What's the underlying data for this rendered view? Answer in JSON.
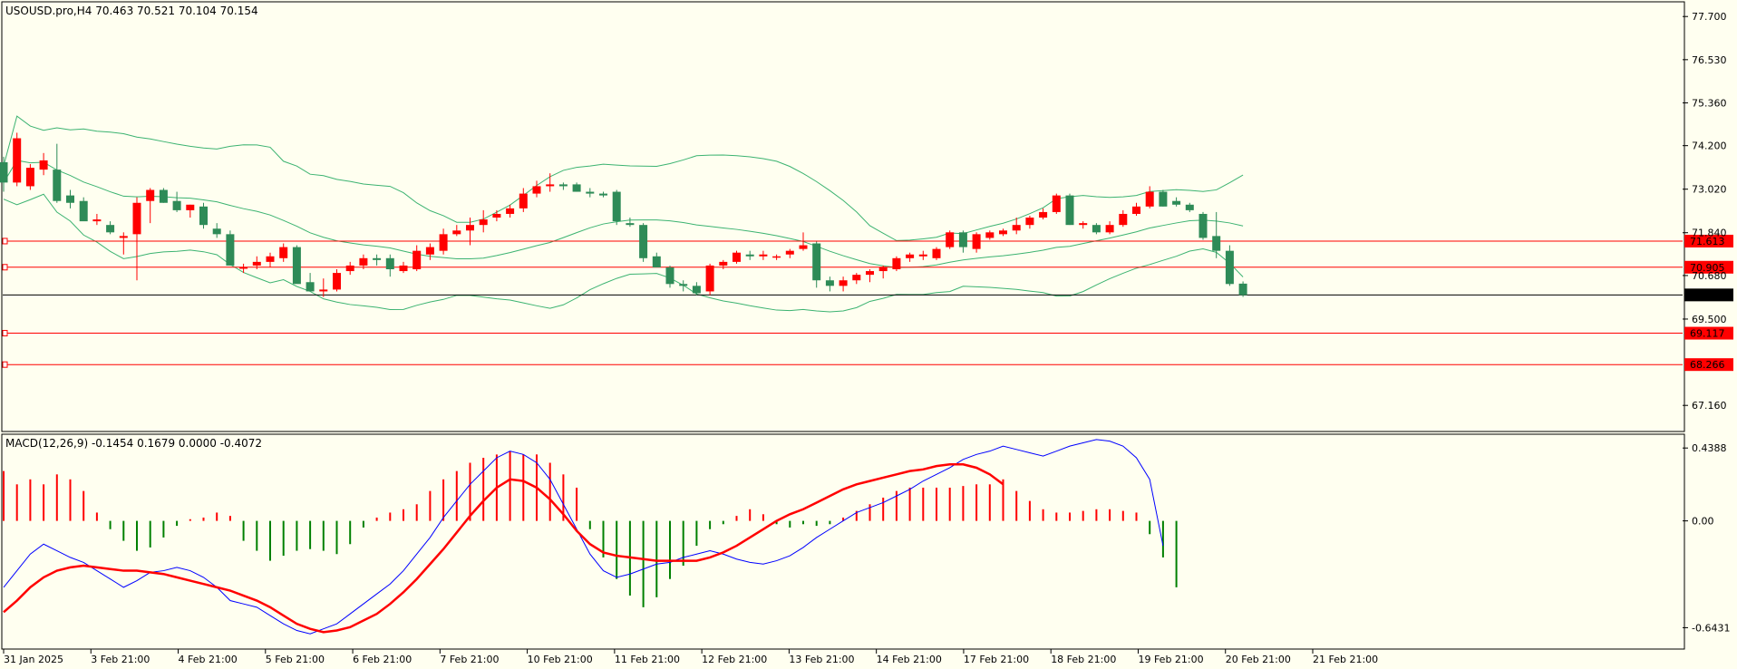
{
  "price_panel": {
    "header": "USOUSD.pro,H4  70.463 70.521 70.104 70.154",
    "price_ticks": [
      "77.700",
      "76.530",
      "75.360",
      "74.200",
      "73.020",
      "71.840",
      "70.680",
      "69.500",
      "67.160"
    ],
    "current_price_label": "70.154",
    "hlines": [
      {
        "label": "71.613",
        "value": 71.613
      },
      {
        "label": "70.905",
        "value": 70.905
      },
      {
        "label": "69.117",
        "value": 69.117
      },
      {
        "label": "68.266",
        "value": 68.266
      }
    ]
  },
  "macd_panel": {
    "header": "MACD(12,26,9) -0.1454 0.1679 0.0000 -0.4072",
    "ticks": [
      "0.4388",
      "0.00",
      "-0.6431"
    ]
  },
  "time_labels": [
    "31 Jan 2025",
    "3 Feb 21:00",
    "4 Feb 21:00",
    "5 Feb 21:00",
    "6 Feb 21:00",
    "7 Feb 21:00",
    "10 Feb 21:00",
    "11 Feb 21:00",
    "12 Feb 21:00",
    "13 Feb 21:00",
    "14 Feb 21:00",
    "17 Feb 21:00",
    "18 Feb 21:00",
    "19 Feb 21:00",
    "20 Feb 21:00",
    "21 Feb 21:00"
  ],
  "colors": {
    "background": "#fffff0",
    "bull": "#ff0000",
    "bear": "#2e8b57",
    "band": "#3cb371",
    "hline": "#ff0000",
    "macd_line": "#0000ff",
    "signal_line": "#ff0000",
    "hist_pos": "#ff0000",
    "hist_neg": "#008000"
  },
  "chart_data": {
    "type": "candlestick",
    "symbol": "USOUSD.pro",
    "timeframe": "H4",
    "ohlc_last": {
      "open": 70.463,
      "high": 70.521,
      "low": 70.104,
      "close": 70.154
    },
    "y_range": [
      66.6,
      78.0
    ],
    "candles": [
      [
        73.75,
        73.9,
        72.95,
        73.2
      ],
      [
        73.2,
        74.55,
        73.1,
        74.4
      ],
      [
        73.1,
        73.7,
        73.0,
        73.6
      ],
      [
        73.55,
        74.0,
        73.4,
        73.8
      ],
      [
        73.55,
        74.25,
        72.65,
        72.7
      ],
      [
        72.85,
        73.0,
        72.5,
        72.65
      ],
      [
        72.7,
        72.8,
        72.25,
        72.15
      ],
      [
        72.15,
        72.35,
        72.05,
        72.2
      ],
      [
        72.05,
        72.15,
        71.8,
        71.85
      ],
      [
        71.7,
        71.85,
        71.25,
        71.75
      ],
      [
        71.8,
        72.8,
        70.55,
        72.65
      ],
      [
        72.7,
        73.05,
        72.1,
        73.0
      ],
      [
        73.0,
        73.05,
        72.65,
        72.65
      ],
      [
        72.7,
        72.95,
        72.4,
        72.45
      ],
      [
        72.45,
        72.6,
        72.25,
        72.6
      ],
      [
        72.55,
        72.65,
        71.95,
        72.05
      ],
      [
        71.95,
        72.1,
        71.7,
        71.8
      ],
      [
        71.8,
        71.9,
        70.95,
        70.95
      ],
      [
        70.9,
        71.0,
        70.75,
        70.9
      ],
      [
        70.95,
        71.2,
        70.85,
        71.05
      ],
      [
        71.05,
        71.3,
        70.9,
        71.2
      ],
      [
        71.15,
        71.55,
        71.05,
        71.45
      ],
      [
        71.45,
        71.5,
        70.55,
        70.45
      ],
      [
        70.5,
        70.75,
        70.35,
        70.25
      ],
      [
        70.25,
        70.6,
        70.1,
        70.3
      ],
      [
        70.3,
        70.85,
        70.25,
        70.75
      ],
      [
        70.8,
        71.05,
        70.7,
        70.95
      ],
      [
        70.95,
        71.25,
        70.85,
        71.15
      ],
      [
        71.15,
        71.25,
        70.95,
        71.1
      ],
      [
        71.15,
        71.25,
        70.65,
        70.85
      ],
      [
        70.8,
        71.05,
        70.75,
        70.95
      ],
      [
        70.85,
        71.5,
        70.8,
        71.35
      ],
      [
        71.25,
        71.55,
        71.1,
        71.45
      ],
      [
        71.35,
        71.95,
        71.25,
        71.8
      ],
      [
        71.8,
        72.05,
        71.75,
        71.9
      ],
      [
        71.9,
        72.25,
        71.5,
        72.05
      ],
      [
        72.05,
        72.45,
        71.85,
        72.2
      ],
      [
        72.25,
        72.45,
        72.15,
        72.35
      ],
      [
        72.35,
        72.6,
        72.25,
        72.5
      ],
      [
        72.5,
        73.05,
        72.4,
        72.9
      ],
      [
        72.9,
        73.25,
        72.8,
        73.1
      ],
      [
        73.1,
        73.45,
        72.95,
        73.15
      ],
      [
        73.15,
        73.2,
        73.0,
        73.1
      ],
      [
        73.15,
        73.2,
        72.95,
        72.95
      ],
      [
        72.95,
        73.05,
        72.8,
        72.9
      ],
      [
        72.9,
        72.95,
        72.8,
        72.85
      ],
      [
        72.95,
        73.0,
        72.05,
        72.15
      ],
      [
        72.1,
        72.25,
        72.0,
        72.05
      ],
      [
        72.05,
        72.1,
        71.05,
        71.15
      ],
      [
        71.2,
        71.3,
        70.9,
        70.9
      ],
      [
        70.9,
        70.95,
        70.35,
        70.45
      ],
      [
        70.45,
        70.55,
        70.25,
        70.4
      ],
      [
        70.4,
        70.5,
        70.15,
        70.2
      ],
      [
        70.25,
        71.0,
        70.15,
        70.95
      ],
      [
        70.95,
        71.1,
        70.85,
        71.05
      ],
      [
        71.05,
        71.35,
        71.0,
        71.3
      ],
      [
        71.25,
        71.35,
        71.1,
        71.2
      ],
      [
        71.2,
        71.35,
        71.1,
        71.25
      ],
      [
        71.2,
        71.25,
        71.1,
        71.2
      ],
      [
        71.25,
        71.4,
        71.15,
        71.35
      ],
      [
        71.4,
        71.85,
        71.35,
        71.5
      ],
      [
        71.55,
        71.6,
        70.35,
        70.55
      ],
      [
        70.55,
        70.65,
        70.25,
        70.4
      ],
      [
        70.4,
        70.65,
        70.25,
        70.55
      ],
      [
        70.55,
        70.75,
        70.45,
        70.7
      ],
      [
        70.7,
        70.85,
        70.5,
        70.8
      ],
      [
        70.8,
        70.95,
        70.6,
        70.9
      ],
      [
        70.85,
        71.2,
        70.8,
        71.15
      ],
      [
        71.15,
        71.3,
        71.05,
        71.25
      ],
      [
        71.2,
        71.35,
        71.1,
        71.25
      ],
      [
        71.15,
        71.45,
        71.1,
        71.4
      ],
      [
        71.45,
        71.9,
        71.4,
        71.85
      ],
      [
        71.85,
        71.9,
        71.3,
        71.45
      ],
      [
        71.4,
        71.85,
        71.3,
        71.8
      ],
      [
        71.7,
        71.9,
        71.65,
        71.85
      ],
      [
        71.8,
        71.95,
        71.75,
        71.9
      ],
      [
        71.9,
        72.25,
        71.8,
        72.05
      ],
      [
        72.05,
        72.3,
        71.95,
        72.25
      ],
      [
        72.25,
        72.5,
        72.2,
        72.4
      ],
      [
        72.4,
        72.9,
        72.35,
        72.85
      ],
      [
        72.85,
        72.9,
        72.05,
        72.05
      ],
      [
        72.05,
        72.15,
        71.95,
        72.1
      ],
      [
        72.05,
        72.1,
        71.8,
        71.85
      ],
      [
        71.85,
        72.15,
        71.8,
        72.05
      ],
      [
        72.05,
        72.45,
        72.0,
        72.35
      ],
      [
        72.35,
        72.65,
        72.3,
        72.55
      ],
      [
        72.55,
        73.1,
        72.5,
        72.95
      ],
      [
        72.95,
        73.0,
        72.55,
        72.55
      ],
      [
        72.7,
        72.8,
        72.55,
        72.6
      ],
      [
        72.6,
        72.65,
        72.4,
        72.45
      ],
      [
        72.35,
        72.4,
        71.65,
        71.7
      ],
      [
        71.75,
        72.4,
        71.15,
        71.35
      ],
      [
        71.35,
        71.5,
        70.4,
        70.45
      ],
      [
        70.46,
        70.52,
        70.1,
        70.15
      ]
    ],
    "macd_hist": [
      0.3,
      0.22,
      0.25,
      0.22,
      0.28,
      0.25,
      0.18,
      0.05,
      -0.05,
      -0.12,
      -0.18,
      -0.16,
      -0.1,
      -0.03,
      0.01,
      0.02,
      0.05,
      0.03,
      -0.12,
      -0.18,
      -0.24,
      -0.21,
      -0.18,
      -0.17,
      -0.18,
      -0.2,
      -0.14,
      -0.04,
      0.02,
      0.05,
      0.07,
      0.1,
      0.18,
      0.25,
      0.3,
      0.35,
      0.38,
      0.4,
      0.42,
      0.4,
      0.4,
      0.35,
      0.28,
      0.2,
      -0.05,
      -0.22,
      -0.35,
      -0.45,
      -0.52,
      -0.46,
      -0.35,
      -0.27,
      -0.15,
      -0.05,
      -0.02,
      0.03,
      0.07,
      0.04,
      -0.02,
      -0.04,
      -0.02,
      -0.03,
      -0.02,
      0.02,
      0.06,
      0.1,
      0.14,
      0.18,
      0.2,
      0.2,
      0.2,
      0.2,
      0.21,
      0.22,
      0.22,
      0.25,
      0.18,
      0.12,
      0.07,
      0.05,
      0.05,
      0.06,
      0.07,
      0.07,
      0.06,
      0.05,
      -0.08,
      -0.22,
      -0.4
    ],
    "macd_line": [
      -0.4,
      -0.3,
      -0.2,
      -0.14,
      -0.18,
      -0.22,
      -0.25,
      -0.3,
      -0.35,
      -0.4,
      -0.36,
      -0.31,
      -0.3,
      -0.28,
      -0.3,
      -0.34,
      -0.4,
      -0.48,
      -0.5,
      -0.52,
      -0.57,
      -0.62,
      -0.66,
      -0.68,
      -0.65,
      -0.62,
      -0.56,
      -0.5,
      -0.44,
      -0.38,
      -0.3,
      -0.2,
      -0.1,
      0.02,
      0.12,
      0.22,
      0.3,
      0.38,
      0.42,
      0.4,
      0.35,
      0.25,
      0.1,
      -0.05,
      -0.2,
      -0.3,
      -0.34,
      -0.32,
      -0.29,
      -0.26,
      -0.25,
      -0.22,
      -0.2,
      -0.18,
      -0.2,
      -0.23,
      -0.25,
      -0.26,
      -0.24,
      -0.21,
      -0.16,
      -0.1,
      -0.05,
      0.0,
      0.05,
      0.08,
      0.11,
      0.15,
      0.19,
      0.24,
      0.28,
      0.32,
      0.37,
      0.4,
      0.42,
      0.45,
      0.43,
      0.41,
      0.39,
      0.42,
      0.45,
      0.47,
      0.49,
      0.48,
      0.45,
      0.38,
      0.25,
      -0.15
    ],
    "signal_line": [
      -0.55,
      -0.48,
      -0.4,
      -0.34,
      -0.3,
      -0.28,
      -0.27,
      -0.28,
      -0.29,
      -0.3,
      -0.3,
      -0.31,
      -0.32,
      -0.34,
      -0.36,
      -0.38,
      -0.4,
      -0.42,
      -0.45,
      -0.48,
      -0.52,
      -0.57,
      -0.62,
      -0.65,
      -0.67,
      -0.66,
      -0.64,
      -0.6,
      -0.56,
      -0.5,
      -0.43,
      -0.35,
      -0.26,
      -0.17,
      -0.07,
      0.03,
      0.12,
      0.2,
      0.25,
      0.24,
      0.2,
      0.13,
      0.04,
      -0.06,
      -0.14,
      -0.19,
      -0.21,
      -0.22,
      -0.23,
      -0.24,
      -0.24,
      -0.24,
      -0.24,
      -0.22,
      -0.19,
      -0.15,
      -0.1,
      -0.05,
      0.0,
      0.04,
      0.07,
      0.11,
      0.15,
      0.19,
      0.22,
      0.24,
      0.26,
      0.28,
      0.3,
      0.31,
      0.33,
      0.34,
      0.34,
      0.32,
      0.28,
      0.22
    ]
  }
}
